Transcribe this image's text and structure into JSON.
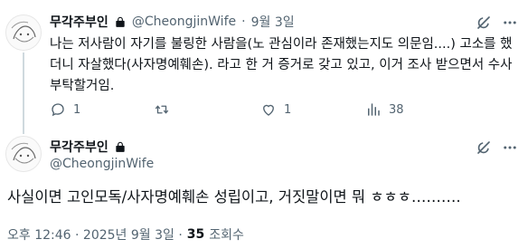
{
  "colors": {
    "text": "#0f1419",
    "muted": "#536471",
    "line": "#cfd9de",
    "bg": "#ffffff"
  },
  "tweet1": {
    "display_name": "무각주부인",
    "handle": "@CheongjinWife",
    "separator": "·",
    "date": "9월 3일",
    "body_lines": [
      "나는 저사람이 자기를 불링한 사람을(노 관심이라 존재했는지도 의문임....) 고소를 했",
      "더니 자살했다(사자명예훼손). 라고 한 거 증거로 갖고 있고, 이거 조사 받으면서 수사",
      "부탁할거임."
    ],
    "actions": {
      "reply": "1",
      "retweet": "",
      "like": "1",
      "views": "38"
    }
  },
  "tweet2": {
    "display_name": "무각주부인",
    "handle": "@CheongjinWife",
    "body": "사실이면 고인모독/사자명예훼손 성립이고, 거짓말이면 뭐 ㅎㅎㅎ……….",
    "meta_time_date": "오후 12:46 · 2025년 9월 3일 ·",
    "meta_views_count": "35",
    "meta_views_label": "조회수"
  },
  "icons": {
    "lock": "lock-icon",
    "grok": "grok-icon",
    "more": "more-icon",
    "reply": "reply-icon",
    "retweet": "retweet-icon",
    "like": "like-icon",
    "views": "views-icon"
  }
}
